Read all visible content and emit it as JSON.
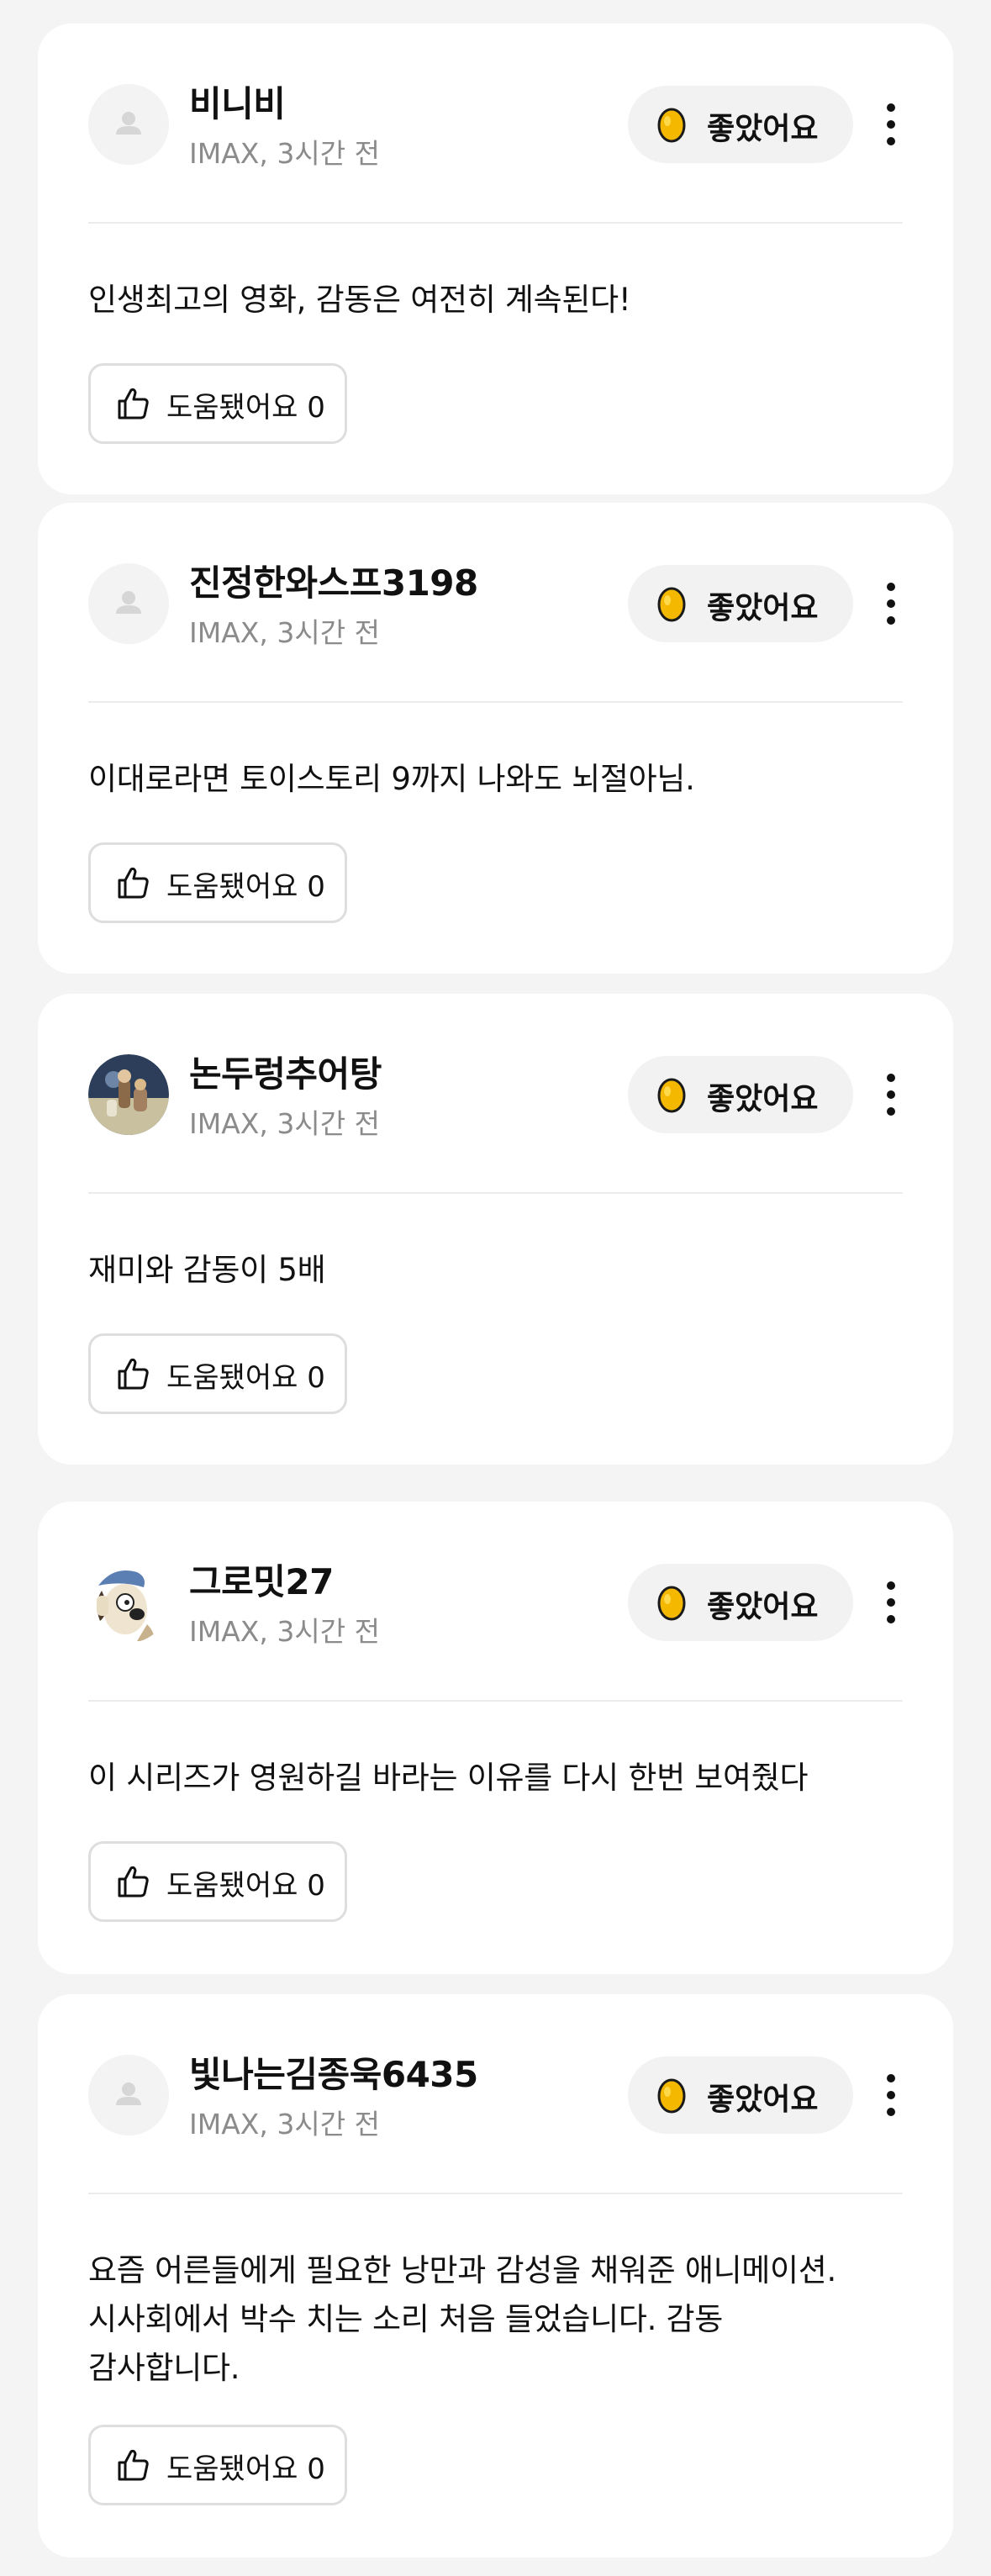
{
  "reviews": [
    {
      "username": "비니비",
      "meta": "IMAX, 3시간 전",
      "avatar_icon": "default-user-icon",
      "reaction_label": "좋았어요",
      "reaction_icon": "golden-egg-icon",
      "text": "인생최고의 영화, 감동은 여전히 계속된다!",
      "helpful_label": "도움됐어요 0"
    },
    {
      "username": "진정한와스프3198",
      "meta": "IMAX, 3시간 전",
      "avatar_icon": "default-user-icon",
      "reaction_label": "좋았어요",
      "reaction_icon": "golden-egg-icon",
      "text": "이대로라면 토이스토리 9까지 나와도 뇌절아님.",
      "helpful_label": "도움됐어요 0"
    },
    {
      "username": "논두렁추어탕",
      "meta": "IMAX, 3시간 전",
      "avatar_icon": "photo-avatar",
      "reaction_label": "좋았어요",
      "reaction_icon": "golden-egg-icon",
      "text": "재미와 감동이 5배",
      "helpful_label": "도움됐어요 0"
    },
    {
      "username": "그로밋27",
      "meta": "IMAX, 3시간 전",
      "avatar_icon": "character-avatar",
      "reaction_label": "좋았어요",
      "reaction_icon": "golden-egg-icon",
      "text": "이 시리즈가 영원하길 바라는 이유를 다시 한번 보여줬다",
      "helpful_label": "도움됐어요 0"
    },
    {
      "username": "빛나는김종욱6435",
      "meta": "IMAX, 3시간 전",
      "avatar_icon": "default-user-icon",
      "reaction_label": "좋았어요",
      "reaction_icon": "golden-egg-icon",
      "text_lines": [
        "요즘 어른들에게 필요한 낭만과 감성을 채워준 애니메이션.",
        "시사회에서 박수 치는 소리 처음 들었습니다. 감동",
        "감사합니다."
      ],
      "helpful_label": "도움됐어요 0"
    }
  ],
  "colors": {
    "page_bg": "#f4f4f4",
    "card_bg": "#ffffff",
    "pill_bg": "#f2f2f2",
    "egg_fill": "#f5b800",
    "meta_text": "#8b8b8b"
  }
}
